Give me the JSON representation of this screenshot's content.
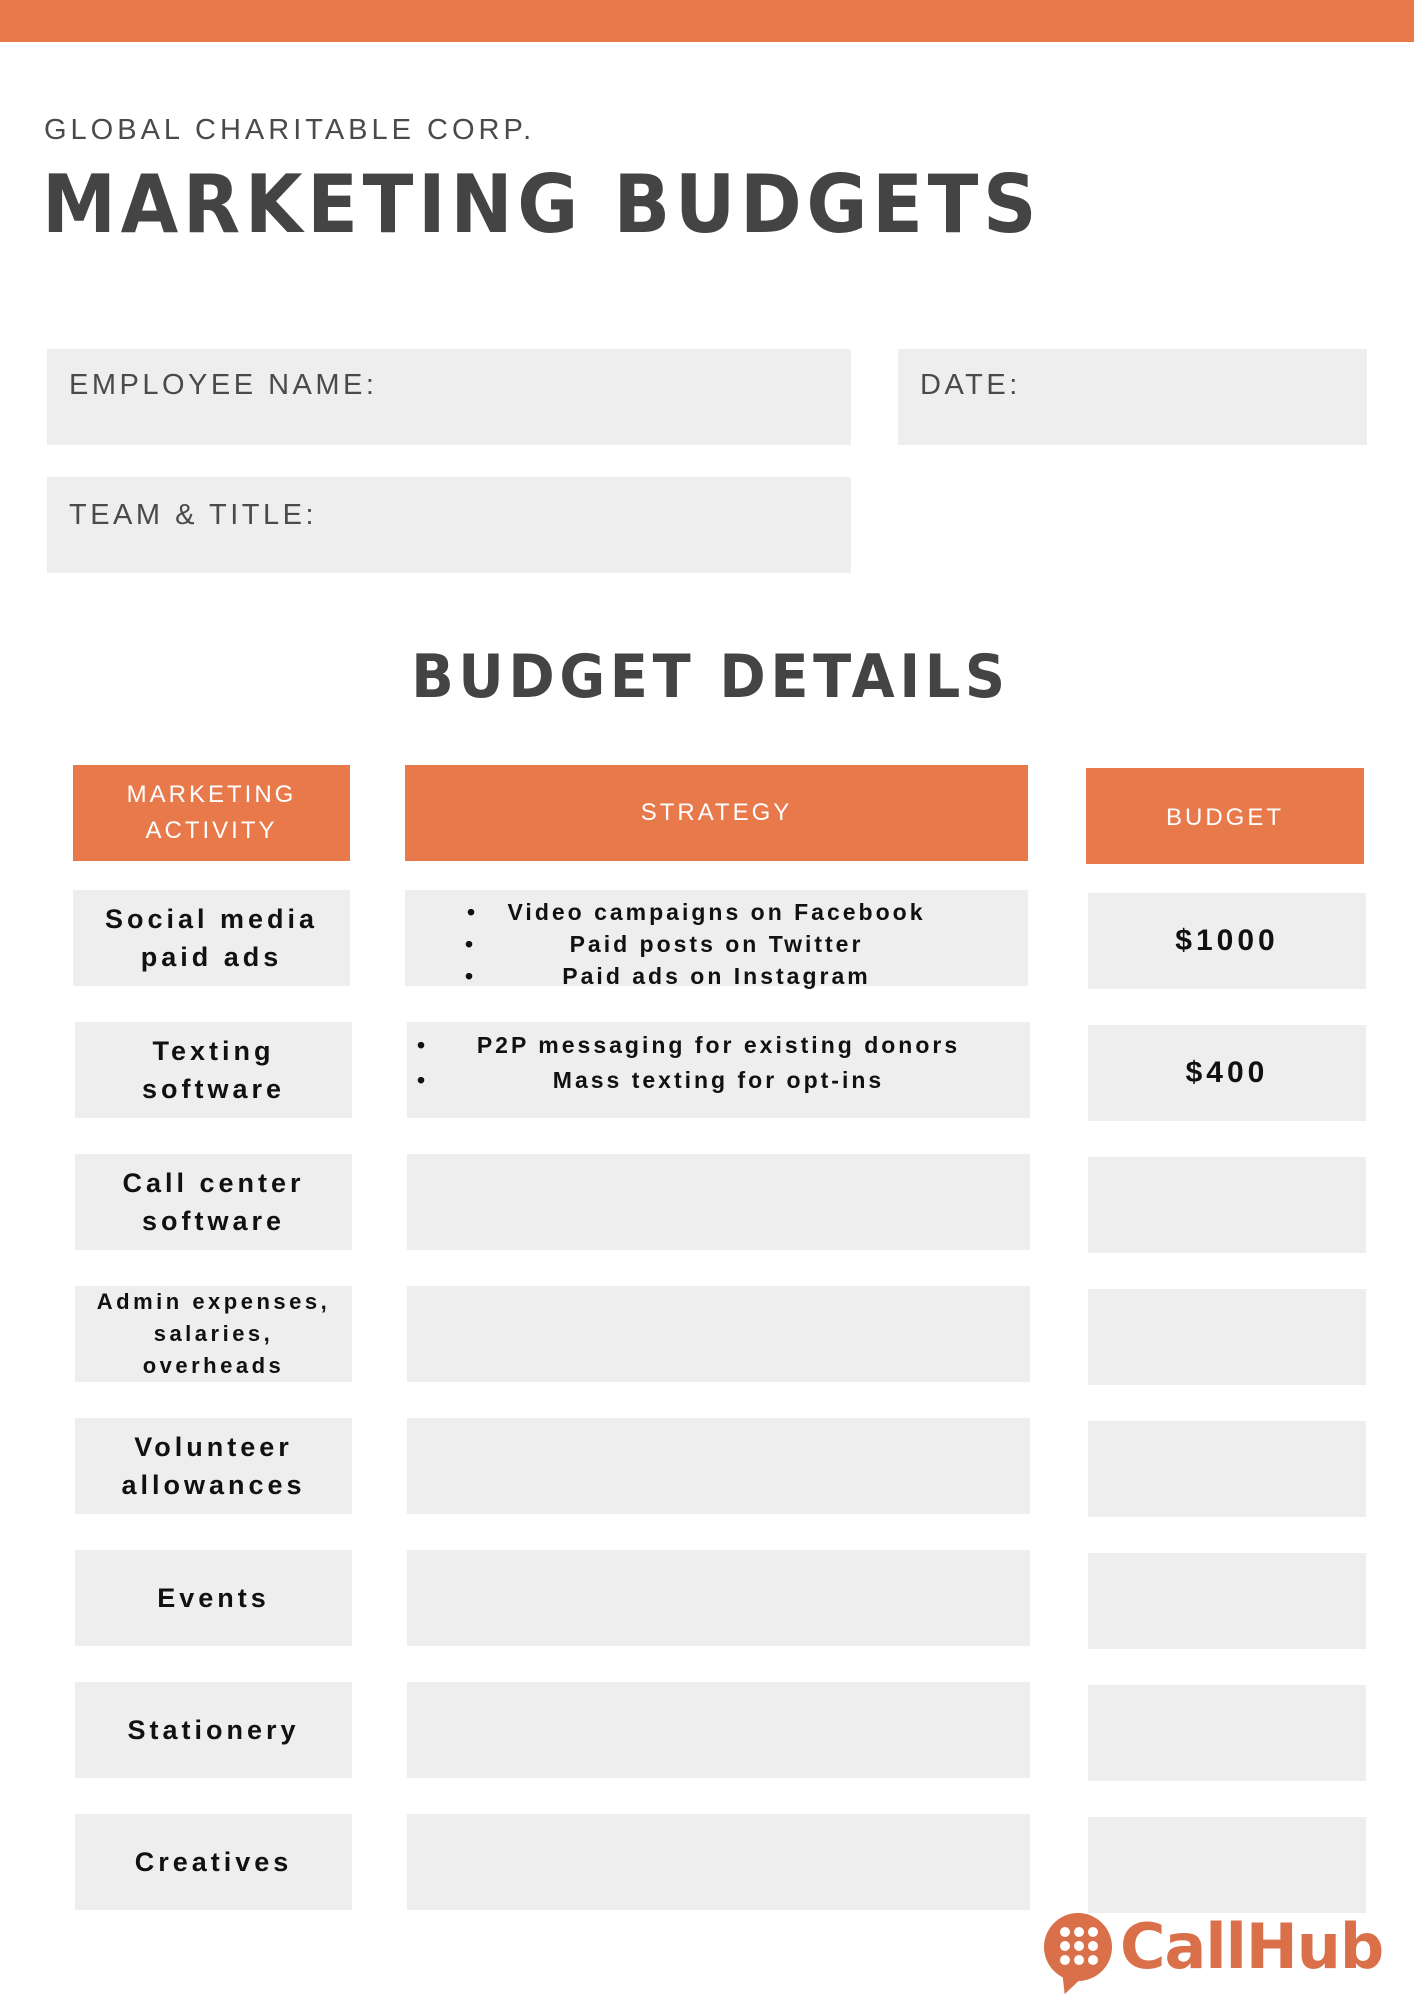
{
  "colors": {
    "accent": "#e8794b",
    "cell_bg": "#eeeeee",
    "heading": "#444444",
    "logo": "#d9704a"
  },
  "header": {
    "organization": "GLOBAL CHARITABLE CORP.",
    "title": "MARKETING BUDGETS"
  },
  "form": {
    "employee_name_label": "EMPLOYEE NAME:",
    "employee_name_value": "",
    "date_label": "DATE:",
    "date_value": "",
    "team_title_label": "TEAM & TITLE:",
    "team_title_value": ""
  },
  "budget": {
    "section_title": "BUDGET DETAILS",
    "columns": [
      "MARKETING ACTIVITY",
      "STRATEGY",
      "BUDGET"
    ],
    "column_lines": [
      [
        "MARKETING",
        "ACTIVITY"
      ],
      [
        "STRATEGY"
      ],
      [
        "BUDGET"
      ]
    ],
    "rows": [
      {
        "activity": [
          "Social media",
          "paid ads"
        ],
        "strategy": [
          "Video campaigns on Facebook",
          "Paid posts on Twitter",
          "Paid ads on Instagram"
        ],
        "budget": "$1000"
      },
      {
        "activity": [
          "Texting",
          "software"
        ],
        "strategy": [
          "P2P messaging for existing donors",
          "Mass texting for opt-ins"
        ],
        "budget": "$400"
      },
      {
        "activity": [
          "Call center",
          "software"
        ],
        "strategy": [],
        "budget": ""
      },
      {
        "activity": [
          "Admin expenses,",
          "salaries,",
          "overheads"
        ],
        "strategy": [],
        "budget": ""
      },
      {
        "activity": [
          "Volunteer",
          "allowances"
        ],
        "strategy": [],
        "budget": ""
      },
      {
        "activity": [
          "Events"
        ],
        "strategy": [],
        "budget": ""
      },
      {
        "activity": [
          "Stationery"
        ],
        "strategy": [],
        "budget": ""
      },
      {
        "activity": [
          "Creatives"
        ],
        "strategy": [],
        "budget": ""
      }
    ]
  },
  "branding": {
    "logo_text": "CallHub",
    "logo_icon": "chat-bubble-keypad-icon",
    "bullet_glyph": "•"
  }
}
